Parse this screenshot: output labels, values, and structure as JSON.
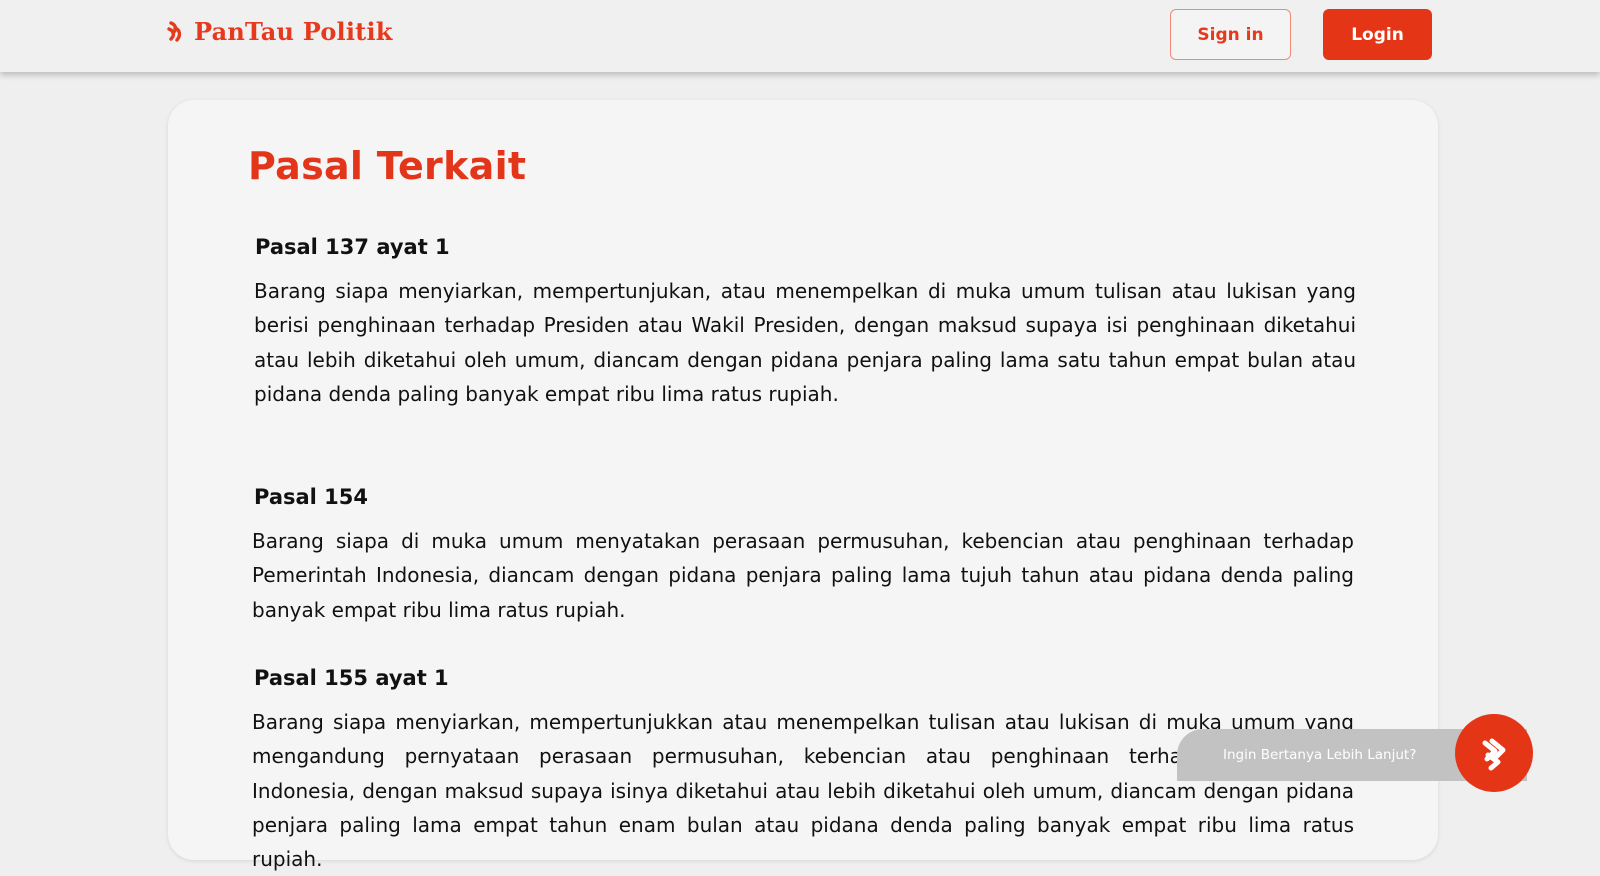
{
  "header": {
    "brand_name": "PanTau Politik",
    "brand_icon": "flame-stripes-icon",
    "signin_label": "Sign in",
    "login_label": "Login"
  },
  "main": {
    "title": "Pasal Terkait",
    "articles": [
      {
        "title": "Pasal 137 ayat 1",
        "body": "Barang siapa menyiarkan, mempertunjukan, atau menempelkan di muka umum  tulisan atau lukisan yang berisi penghinaan terhadap Presiden atau Wakil Presiden,  dengan maksud supaya isi penghinaan diketahui atau lebih diketahui oleh umum,  diancam dengan pidana penjara paling lama satu tahun empat bulan atau pidana denda  paling banyak empat ribu lima ratus rupiah."
      },
      {
        "title": "Pasal 154",
        "body": "Barang siapa di muka umum menyatakan perasaan permusuhan, kebencian atau penghinaan terhadap Pemerintah Indonesia, diancam dengan pidana penjara paling  lama tujuh tahun atau pidana denda paling banyak empat ribu lima ratus rupiah."
      },
      {
        "title": "Pasal 155 ayat 1",
        "body": "Barang siapa menyiarkan, mempertunjukkan atau menempelkan tulisan atau lukisan  di muka umum yang mengandung pernyataan perasaan permusuhan, kebencian atau penghinaan terhadap Pemerintah Indonesia, dengan maksud supaya isinya diketahui  atau lebih diketahui oleh umum, diancam dengan pidana penjara paling lama empat tahun enam bulan atau pidana denda paling banyak empat ribu lima ratus rupiah."
      }
    ]
  },
  "chat": {
    "prompt": "Ingin Bertanya Lebih Lanjut?",
    "icon": "flame-stripes-icon"
  },
  "colors": {
    "accent": "#e53517",
    "background": "#efefef",
    "card": "#f5f5f5"
  }
}
